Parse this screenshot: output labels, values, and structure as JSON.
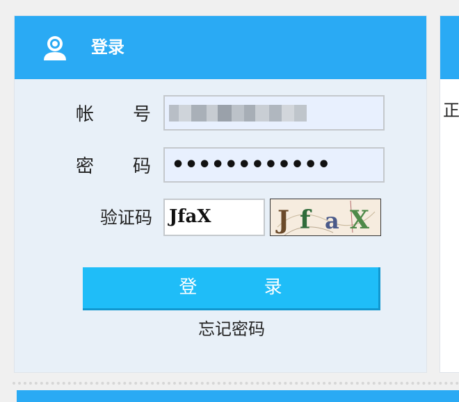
{
  "login": {
    "title": "登录",
    "account_label": "帐 号",
    "password_label": "密 码",
    "captcha_label": "验证码",
    "password_masked": "••••••••••••",
    "captcha_value": "JfaX",
    "captcha_image_text": "JfaX",
    "login_button": "登 录",
    "forgot_link": "忘记密码"
  },
  "right_panel": {
    "visible_text": "正"
  },
  "colors": {
    "header_blue": "#2aaaf4",
    "button_blue": "#1fbdf8",
    "panel_bg": "#e8f0f8",
    "input_bg": "#e8f0fe"
  },
  "icons": [
    "user-icon"
  ]
}
